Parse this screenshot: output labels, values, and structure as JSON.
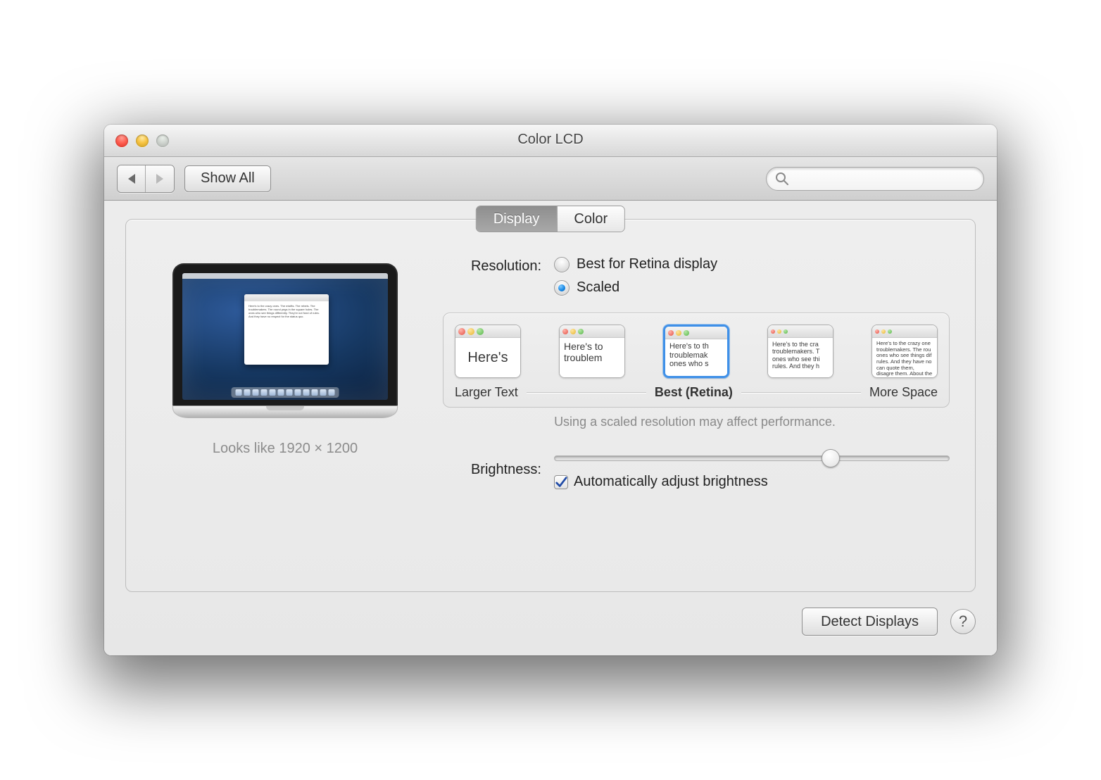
{
  "window": {
    "title": "Color LCD"
  },
  "toolbar": {
    "show_all": "Show All",
    "search_placeholder": ""
  },
  "tabs": {
    "display": "Display",
    "color": "Color",
    "selected": "Display"
  },
  "preview": {
    "caption": "Looks like 1920 × 1200"
  },
  "resolution": {
    "label": "Resolution:",
    "option_best": "Best for Retina display",
    "option_scaled": "Scaled",
    "selected": "Scaled",
    "scale_caption_left": "Larger Text",
    "scale_caption_mid": "Best (Retina)",
    "scale_caption_right": "More Space",
    "thumbs": [
      {
        "text": "Here's"
      },
      {
        "text": "Here's to troublem"
      },
      {
        "text": "Here's to th troublemak ones who s"
      },
      {
        "text": "Here's to the cra troublemakers. T ones who see thi rules. And they h"
      },
      {
        "text": "Here's to the crazy one troublemakers. The rou ones who see things dif rules. And they have no can quote them, disagre them. About the only thi Because they change th"
      }
    ],
    "selected_thumb_index": 2,
    "performance_note": "Using a scaled resolution may affect performance."
  },
  "brightness": {
    "label": "Brightness:",
    "value_percent": 70,
    "auto_label": "Automatically adjust brightness",
    "auto_checked": true
  },
  "footer": {
    "detect": "Detect Displays",
    "help": "?"
  }
}
